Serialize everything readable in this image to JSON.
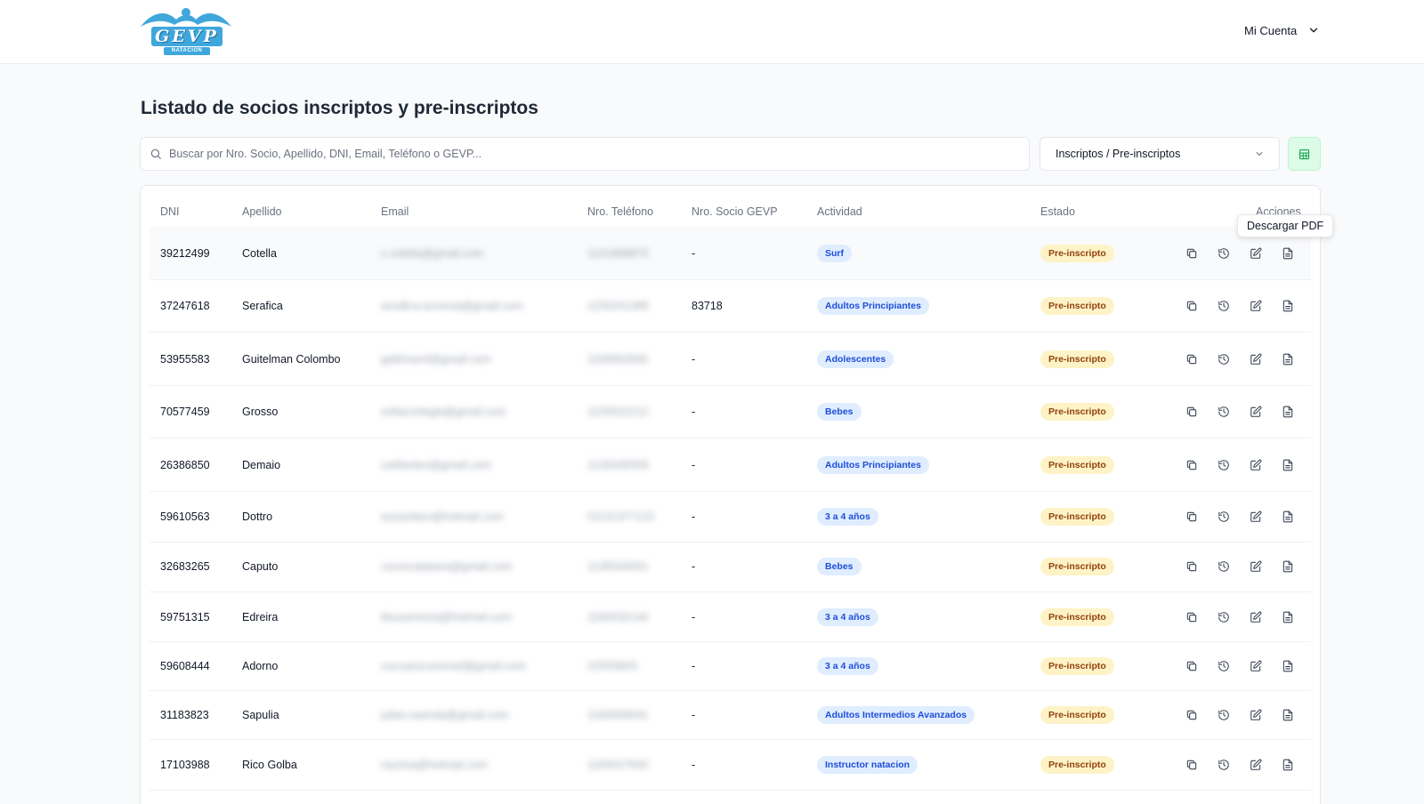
{
  "header": {
    "logo_text": "GEVP",
    "logo_sub": "NATACIÓN",
    "account_label": "Mi Cuenta"
  },
  "page": {
    "title": "Listado de socios inscriptos y pre-inscriptos"
  },
  "search": {
    "placeholder": "Buscar por Nro. Socio, Apellido, DNI, Email, Teléfono o GEVP...",
    "value": ""
  },
  "filter": {
    "selected": "Inscriptos / Pre-inscriptos"
  },
  "table": {
    "headers": [
      "DNI",
      "Apellido",
      "Email",
      "Nro. Teléfono",
      "Nro. Socio GEVP",
      "Actividad",
      "Estado",
      "Acciones"
    ],
    "rows": [
      {
        "dni": "39212499",
        "apellido": "Cotella",
        "email": "c.cotella@gmail.com",
        "telefono": "1141868870",
        "socio": "-",
        "actividad": "Surf",
        "estado": "Pre-inscripto"
      },
      {
        "dni": "37247618",
        "apellido": "Serafica",
        "email": "serafica.lucresia@gmail.com",
        "telefono": "1155241389",
        "socio": "83718",
        "actividad": "Adultos Principiantes",
        "estado": "Pre-inscripto"
      },
      {
        "dni": "53955583",
        "apellido": "Guitelman Colombo",
        "email": "gatilman4@gmail.com",
        "telefono": "1169563582",
        "socio": "-",
        "actividad": "Adolescentes",
        "estado": "Pre-inscripto"
      },
      {
        "dni": "70577459",
        "apellido": "Grosso",
        "email": "sofiacortegla@gmail.com",
        "telefono": "1155522212",
        "socio": "-",
        "actividad": "Bebes",
        "estado": "Pre-inscripto"
      },
      {
        "dni": "26386850",
        "apellido": "Demaio",
        "email": "carlfantes@gmail.com",
        "telefono": "1133328359",
        "socio": "-",
        "actividad": "Adultos Principiantes",
        "estado": "Pre-inscripto"
      },
      {
        "dni": "59610563",
        "apellido": "Dottro",
        "email": "susanitaro@hotmail.com",
        "telefono": "01131377122",
        "socio": "-",
        "actividad": "3 a 4 años",
        "estado": "Pre-inscripto"
      },
      {
        "dni": "32683265",
        "apellido": "Caputo",
        "email": "cucrocataiana@gmail.com",
        "telefono": "1139334001",
        "socio": "-",
        "actividad": "Bebes",
        "estado": "Pre-inscripto"
      },
      {
        "dni": "59751315",
        "apellido": "Edreira",
        "email": "illuusentoria@hotmail.com",
        "telefono": "1160532144",
        "socio": "-",
        "actividad": "3 a 4 años",
        "estado": "Pre-inscripto"
      },
      {
        "dni": "59608444",
        "apellido": "Adorno",
        "email": "coccasocoosroel@gmail.com",
        "telefono": "22555803",
        "socio": "-",
        "actividad": "3 a 4 años",
        "estado": "Pre-inscripto"
      },
      {
        "dni": "31183823",
        "apellido": "Sapulia",
        "email": "julian.saenda@gmail.com",
        "telefono": "1160059041",
        "socio": "-",
        "actividad": "Adultos Intermedios Avanzados",
        "estado": "Pre-inscripto"
      },
      {
        "dni": "17103988",
        "apellido": "Rico Golba",
        "email": "raurtoa@hotmail.com",
        "telefono": "1165027842",
        "socio": "-",
        "actividad": "Instructor natacion",
        "estado": "Pre-inscripto"
      }
    ]
  },
  "row_actions": [
    "copy-icon",
    "history-icon",
    "edit-icon",
    "file-icon"
  ],
  "tooltip": {
    "text": "Descargar PDF"
  },
  "colors": {
    "activity_pill_bg": "#e0edff",
    "activity_pill_text": "#1d4ed8",
    "status_pill_bg": "#fdf3c6",
    "status_pill_text": "#92400e",
    "excel_button_bg": "#dcfce7"
  }
}
